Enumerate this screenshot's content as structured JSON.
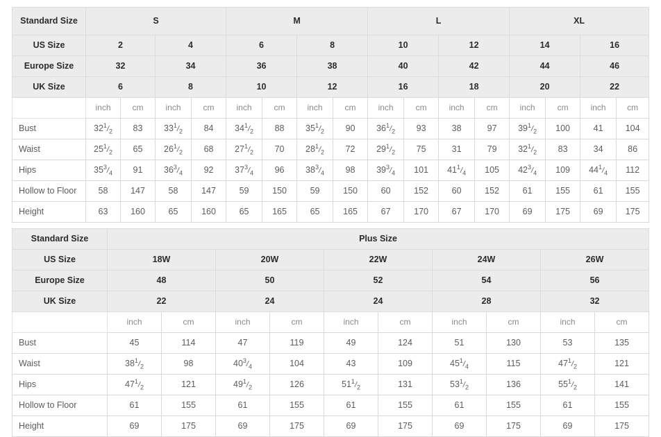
{
  "standard_table": {
    "corner_label": "Standard Size",
    "group_headers": [
      {
        "label": "S",
        "span": 4
      },
      {
        "label": "M",
        "span": 4
      },
      {
        "label": "L",
        "span": 4
      },
      {
        "label": "XL",
        "span": 4
      }
    ],
    "size_rows": [
      {
        "label": "US Size",
        "values": [
          "2",
          "4",
          "6",
          "8",
          "10",
          "12",
          "14",
          "16"
        ]
      },
      {
        "label": "Europe Size",
        "values": [
          "32",
          "34",
          "36",
          "38",
          "40",
          "42",
          "44",
          "46"
        ]
      },
      {
        "label": "UK Size",
        "values": [
          "6",
          "8",
          "10",
          "12",
          "16",
          "18",
          "20",
          "22"
        ]
      }
    ],
    "unit_row": {
      "label": "",
      "units": [
        "inch",
        "cm",
        "inch",
        "cm",
        "inch",
        "cm",
        "inch",
        "cm",
        "inch",
        "cm",
        "inch",
        "cm",
        "inch",
        "cm",
        "inch",
        "cm"
      ]
    },
    "measure_rows": [
      {
        "label": "Bust",
        "values": [
          {
            "whole": "32",
            "num": "1",
            "den": "2"
          },
          "83",
          {
            "whole": "33",
            "num": "1",
            "den": "2"
          },
          "84",
          {
            "whole": "34",
            "num": "1",
            "den": "2"
          },
          "88",
          {
            "whole": "35",
            "num": "1",
            "den": "2"
          },
          "90",
          {
            "whole": "36",
            "num": "1",
            "den": "2"
          },
          "93",
          "38",
          "97",
          {
            "whole": "39",
            "num": "1",
            "den": "2"
          },
          "100",
          "41",
          "104"
        ]
      },
      {
        "label": "Waist",
        "values": [
          {
            "whole": "25",
            "num": "1",
            "den": "2"
          },
          "65",
          {
            "whole": "26",
            "num": "1",
            "den": "2"
          },
          "68",
          {
            "whole": "27",
            "num": "1",
            "den": "2"
          },
          "70",
          {
            "whole": "28",
            "num": "1",
            "den": "2"
          },
          "72",
          {
            "whole": "29",
            "num": "1",
            "den": "2"
          },
          "75",
          "31",
          "79",
          {
            "whole": "32",
            "num": "1",
            "den": "2"
          },
          "83",
          "34",
          "86"
        ]
      },
      {
        "label": "Hips",
        "values": [
          {
            "whole": "35",
            "num": "3",
            "den": "4"
          },
          "91",
          {
            "whole": "36",
            "num": "3",
            "den": "4"
          },
          "92",
          {
            "whole": "37",
            "num": "3",
            "den": "4"
          },
          "96",
          {
            "whole": "38",
            "num": "3",
            "den": "4"
          },
          "98",
          {
            "whole": "39",
            "num": "3",
            "den": "4"
          },
          "101",
          {
            "whole": "41",
            "num": "1",
            "den": "4"
          },
          "105",
          {
            "whole": "42",
            "num": "3",
            "den": "4"
          },
          "109",
          {
            "whole": "44",
            "num": "1",
            "den": "4"
          },
          "112"
        ]
      },
      {
        "label": "Hollow to Floor",
        "values": [
          "58",
          "147",
          "58",
          "147",
          "59",
          "150",
          "59",
          "150",
          "60",
          "152",
          "60",
          "152",
          "61",
          "155",
          "61",
          "155"
        ]
      },
      {
        "label": "Height",
        "values": [
          "63",
          "160",
          "65",
          "160",
          "65",
          "165",
          "65",
          "165",
          "67",
          "170",
          "67",
          "170",
          "69",
          "175",
          "69",
          "175"
        ]
      }
    ]
  },
  "plus_table": {
    "corner_label": "Standard Size",
    "band_label": "Plus Size",
    "size_rows": [
      {
        "label": "US Size",
        "values": [
          "18W",
          "20W",
          "22W",
          "24W",
          "26W"
        ]
      },
      {
        "label": "Europe Size",
        "values": [
          "48",
          "50",
          "52",
          "54",
          "56"
        ]
      },
      {
        "label": "UK Size",
        "values": [
          "22",
          "24",
          "24",
          "28",
          "32"
        ]
      }
    ],
    "unit_row": {
      "label": "",
      "units": [
        "inch",
        "cm",
        "inch",
        "cm",
        "inch",
        "cm",
        "inch",
        "cm",
        "inch",
        "cm"
      ]
    },
    "measure_rows": [
      {
        "label": "Bust",
        "values": [
          "45",
          "114",
          "47",
          "119",
          "49",
          "124",
          "51",
          "130",
          "53",
          "135"
        ]
      },
      {
        "label": "Waist",
        "values": [
          {
            "whole": "38",
            "num": "1",
            "den": "2"
          },
          "98",
          {
            "whole": "40",
            "num": "3",
            "den": "4"
          },
          "104",
          "43",
          "109",
          {
            "whole": "45",
            "num": "1",
            "den": "4"
          },
          "115",
          {
            "whole": "47",
            "num": "1",
            "den": "2"
          },
          "121"
        ]
      },
      {
        "label": "Hips",
        "values": [
          {
            "whole": "47",
            "num": "1",
            "den": "2"
          },
          "121",
          {
            "whole": "49",
            "num": "1",
            "den": "2"
          },
          "126",
          {
            "whole": "51",
            "num": "1",
            "den": "2"
          },
          "131",
          {
            "whole": "53",
            "num": "1",
            "den": "2"
          },
          "136",
          {
            "whole": "55",
            "num": "1",
            "den": "2"
          },
          "141"
        ]
      },
      {
        "label": "Hollow to Floor",
        "values": [
          "61",
          "155",
          "61",
          "155",
          "61",
          "155",
          "61",
          "155",
          "61",
          "155"
        ]
      },
      {
        "label": "Height",
        "values": [
          "69",
          "175",
          "69",
          "175",
          "69",
          "175",
          "69",
          "175",
          "69",
          "175"
        ]
      }
    ]
  },
  "colors": {
    "header_bg": "#ececec",
    "border": "#d9d9d9",
    "header_text": "#2b2b2b",
    "body_text": "#5c5c5c",
    "unit_text": "#8a8a8a",
    "page_bg": "#ffffff"
  }
}
